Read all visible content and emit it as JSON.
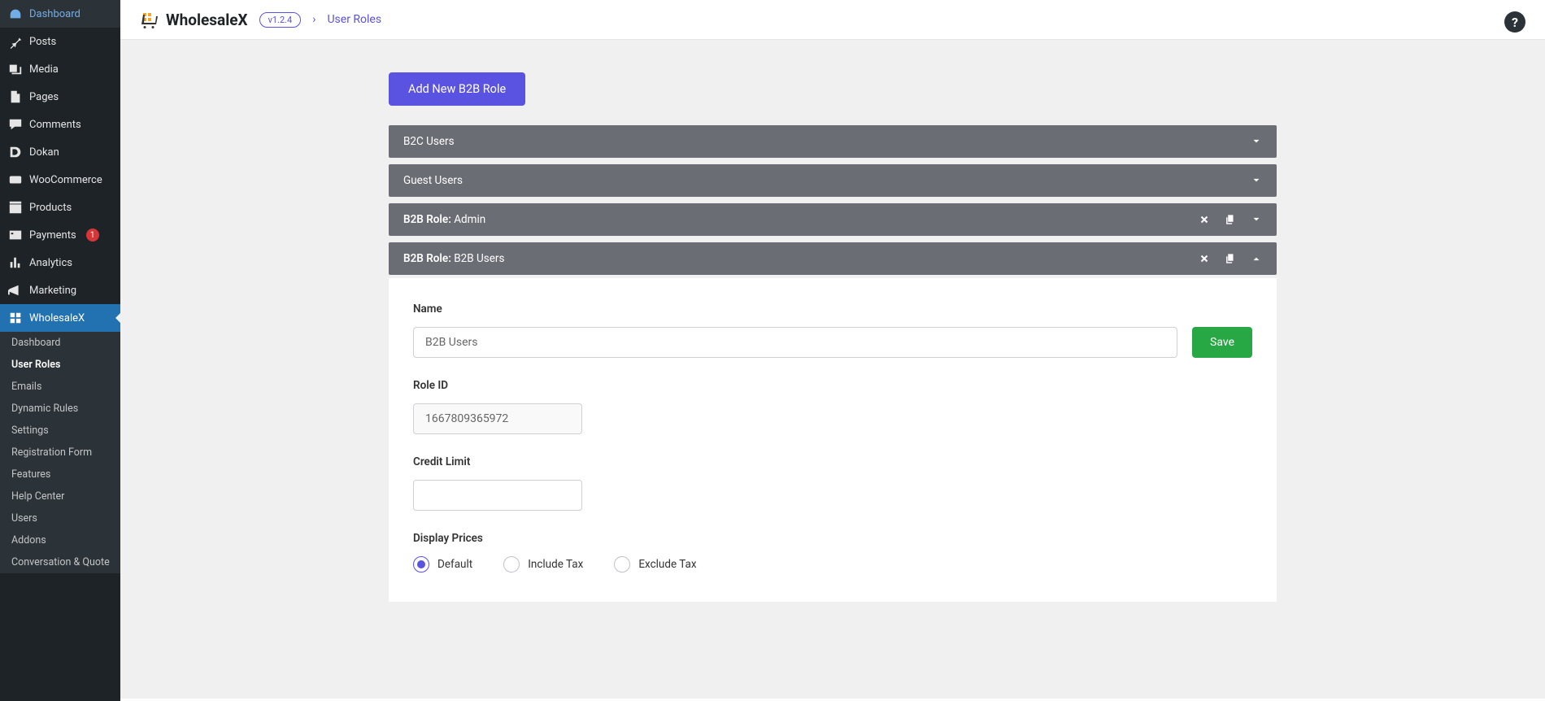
{
  "sidebar": {
    "items": [
      {
        "label": "Dashboard",
        "icon": "dash"
      },
      {
        "label": "Posts",
        "icon": "pin"
      },
      {
        "label": "Media",
        "icon": "media"
      },
      {
        "label": "Pages",
        "icon": "page"
      },
      {
        "label": "Comments",
        "icon": "comment"
      },
      {
        "label": "Dokan",
        "icon": "dokan"
      },
      {
        "label": "WooCommerce",
        "icon": "woo"
      },
      {
        "label": "Products",
        "icon": "box"
      },
      {
        "label": "Payments",
        "icon": "pay",
        "badge": "1"
      },
      {
        "label": "Analytics",
        "icon": "chart"
      },
      {
        "label": "Marketing",
        "icon": "mega"
      },
      {
        "label": "WholesaleX",
        "icon": "wx",
        "active": true
      }
    ],
    "sub": [
      {
        "label": "Dashboard"
      },
      {
        "label": "User Roles",
        "active": true
      },
      {
        "label": "Emails"
      },
      {
        "label": "Dynamic Rules"
      },
      {
        "label": "Settings"
      },
      {
        "label": "Registration Form"
      },
      {
        "label": "Features"
      },
      {
        "label": "Help Center"
      },
      {
        "label": "Users"
      },
      {
        "label": "Addons"
      },
      {
        "label": "Conversation & Quote"
      }
    ]
  },
  "header": {
    "brand": "WholesaleX",
    "version": "v1.2.4",
    "crumb": "User Roles",
    "help": "?"
  },
  "actions": {
    "add": "Add New B2B Role",
    "save": "Save"
  },
  "accordions": [
    {
      "title_plain": "B2C Users"
    },
    {
      "title_plain": "Guest Users"
    },
    {
      "prefix": "B2B Role:",
      "name": "Admin",
      "deletable": true
    },
    {
      "prefix": "B2B Role:",
      "name": "B2B Users",
      "deletable": true,
      "open": true
    }
  ],
  "form": {
    "name_label": "Name",
    "name_value": "B2B Users",
    "roleid_label": "Role ID",
    "roleid_value": "1667809365972",
    "credit_label": "Credit Limit",
    "credit_value": "",
    "prices_label": "Display Prices",
    "prices_options": [
      "Default",
      "Include Tax",
      "Exclude Tax"
    ],
    "prices_selected": 0
  }
}
